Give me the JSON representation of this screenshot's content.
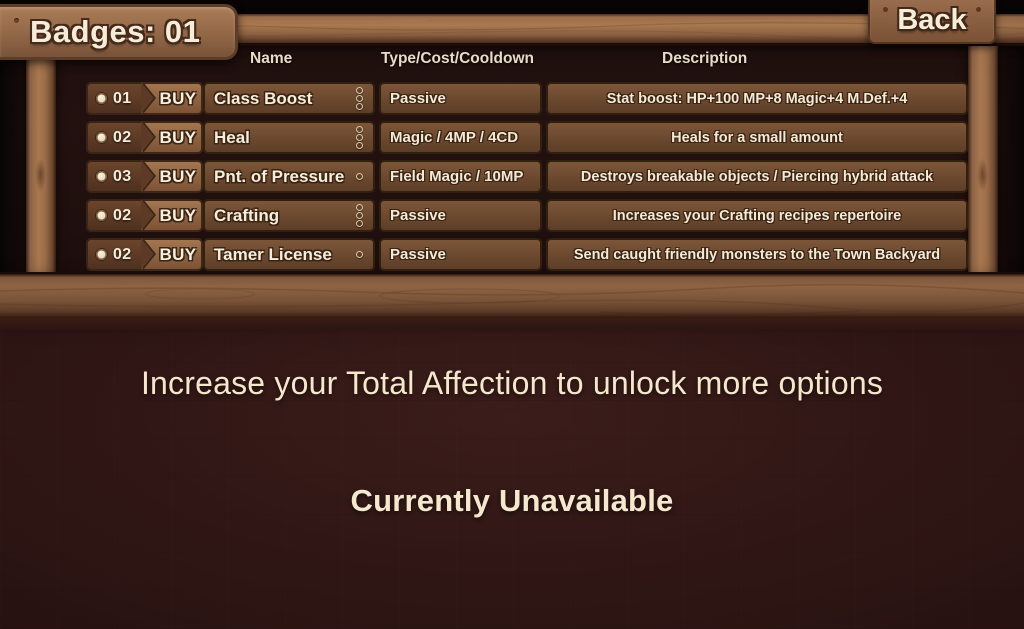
{
  "header": {
    "badges_sign_label": "Badges: 01",
    "back_label": "Back"
  },
  "table": {
    "columns": {
      "name": "Name",
      "type": "Type/Cost/Cooldown",
      "description": "Description"
    },
    "buy_label": "BUY",
    "rows": [
      {
        "cost": "01",
        "buy": "BUY",
        "name": "Class Boost",
        "pips": 3,
        "type": "Passive",
        "description": "Stat boost: HP+100  MP+8  Magic+4  M.Def.+4"
      },
      {
        "cost": "02",
        "buy": "BUY",
        "name": "Heal",
        "pips": 3,
        "type": "Magic / 4MP / 4CD",
        "description": "Heals for a small amount"
      },
      {
        "cost": "03",
        "buy": "BUY",
        "name": "Pnt. of Pressure",
        "pips": 1,
        "type": "Field Magic / 10MP",
        "description": "Destroys breakable objects / Piercing hybrid attack"
      },
      {
        "cost": "02",
        "buy": "BUY",
        "name": "Crafting",
        "pips": 3,
        "type": "Passive",
        "description": "Increases your Crafting recipes repertoire"
      },
      {
        "cost": "02",
        "buy": "BUY",
        "name": "Tamer License",
        "pips": 1,
        "type": "Passive",
        "description": "Send caught friendly monsters to the Town Backyard"
      }
    ]
  },
  "messages": {
    "affection": "Increase your Total Affection to unlock more options",
    "unavailable": "Currently Unavailable"
  },
  "colors": {
    "wood_light": "#a8794f",
    "wood_mid": "#8a6244",
    "wood_dark": "#5e3e28",
    "text_cream": "#f6eeda",
    "outline_dark": "#3a2313",
    "background_dark": "#2e1715"
  }
}
